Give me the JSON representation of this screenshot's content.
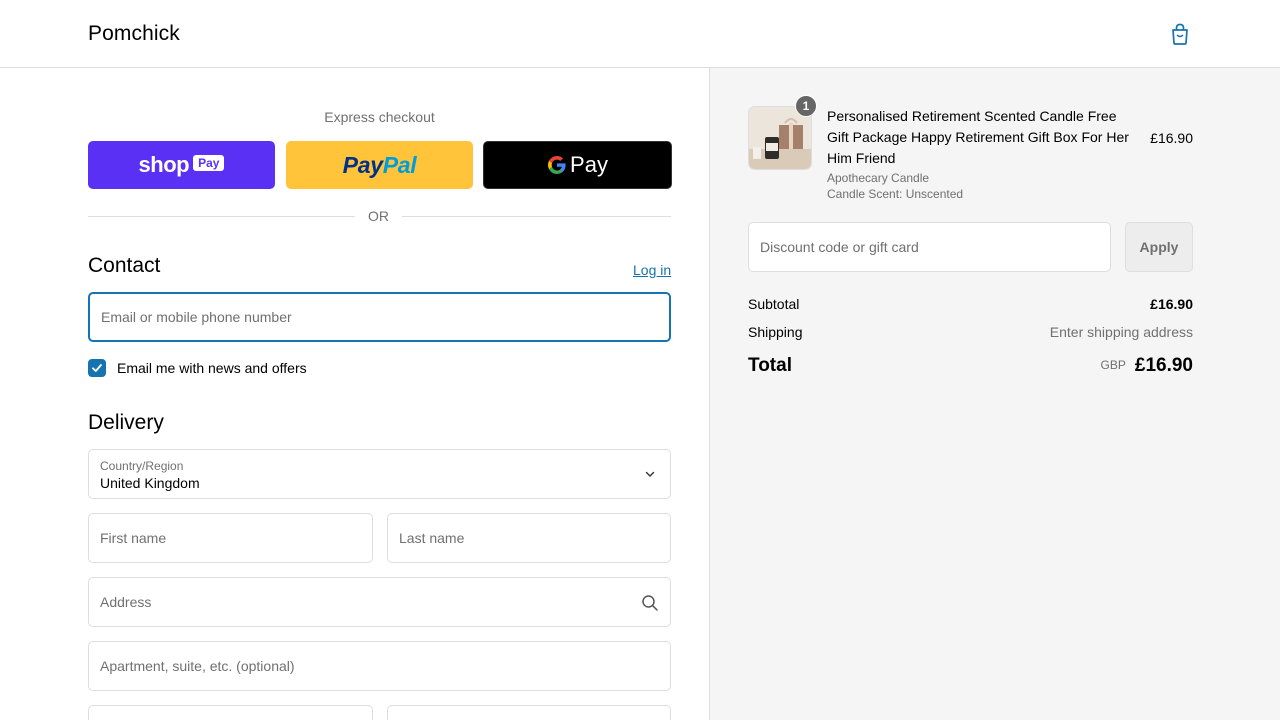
{
  "header": {
    "brand": "Pomchick",
    "cart_icon": "shopping-bag-icon"
  },
  "express": {
    "title": "Express checkout",
    "shop_pay": {
      "word": "shop",
      "tag": "Pay"
    },
    "paypal": {
      "part1": "Pay",
      "part2": "Pal"
    },
    "gpay": {
      "word": "Pay"
    },
    "or_label": "OR"
  },
  "contact": {
    "title": "Contact",
    "login_label": "Log in",
    "email_placeholder": "Email or mobile phone number",
    "newsletter_label": "Email me with news and offers",
    "newsletter_checked": true
  },
  "delivery": {
    "title": "Delivery",
    "country_label": "Country/Region",
    "country_value": "United Kingdom",
    "first_name_placeholder": "First name",
    "last_name_placeholder": "Last name",
    "address_placeholder": "Address",
    "apartment_placeholder": "Apartment, suite, etc. (optional)"
  },
  "order": {
    "item": {
      "quantity": "1",
      "name": "Personalised Retirement Scented Candle Free Gift Package Happy Retirement Gift Box For Her Him Friend",
      "variant1": "Apothecary Candle",
      "variant2": "Candle Scent: Unscented",
      "price": "£16.90"
    },
    "discount_placeholder": "Discount code or gift card",
    "apply_label": "Apply",
    "subtotal_label": "Subtotal",
    "subtotal_value": "£16.90",
    "shipping_label": "Shipping",
    "shipping_value": "Enter shipping address",
    "total_label": "Total",
    "total_currency": "GBP",
    "total_value": "£16.90"
  },
  "colors": {
    "accent": "#1773b0",
    "shop_pay": "#5a31f4",
    "paypal": "#ffc439",
    "gpay": "#000000",
    "summary_bg": "#f5f5f5"
  }
}
